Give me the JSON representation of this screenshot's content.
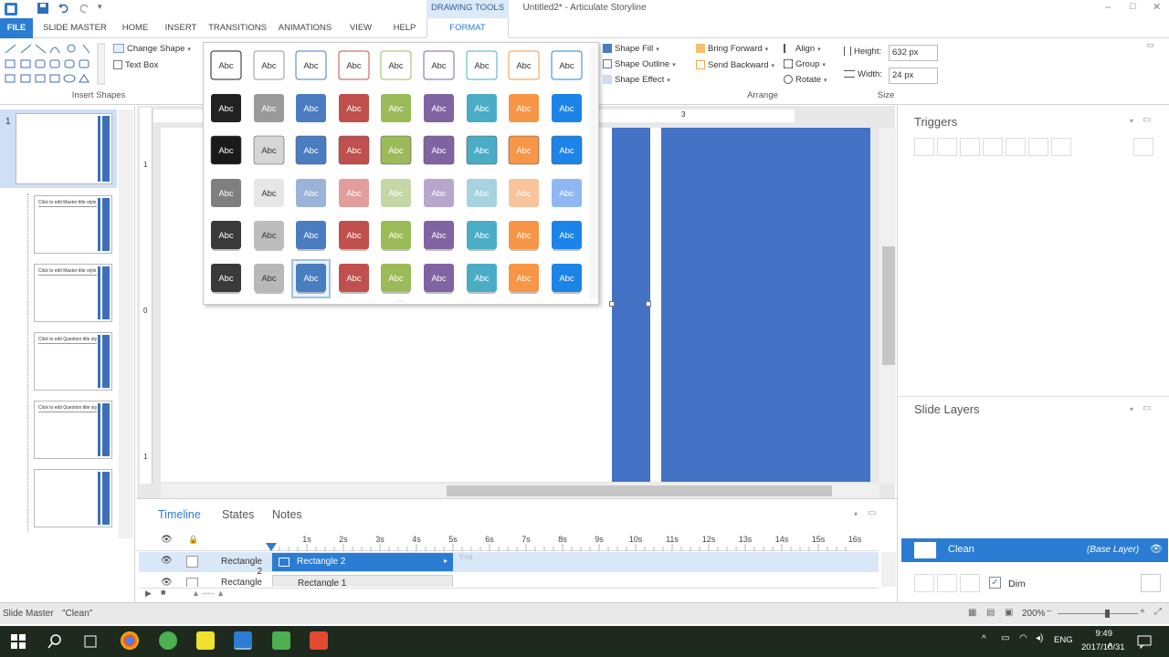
{
  "window": {
    "title": "Untitled2* - Articulate Storyline"
  },
  "context_tab": "DRAWING TOOLS",
  "tabs": [
    "FILE",
    "SLIDE MASTER",
    "HOME",
    "INSERT",
    "TRANSITIONS",
    "ANIMATIONS",
    "VIEW",
    "HELP",
    "FORMAT"
  ],
  "ribbon": {
    "insert_shapes_label": "Insert Shapes",
    "change_shape": "Change Shape",
    "text_box": "Text Box",
    "shape_fill": "Shape Fill",
    "shape_outline": "Shape Outline",
    "shape_effect": "Shape Effect",
    "bring_forward": "Bring Forward",
    "send_backward": "Send Backward",
    "align": "Align",
    "group": "Group",
    "rotate": "Rotate",
    "arrange_label": "Arrange",
    "height_label": "Height:",
    "height_value": "632 px",
    "width_label": "Width:",
    "width_value": "24 px",
    "size_label": "Size"
  },
  "gallery": {
    "swatch_text": "Abc",
    "colors": [
      "#222222",
      "#9a9a9a",
      "#4a7cc0",
      "#c0504d",
      "#9bbb59",
      "#8064a2",
      "#4bacc6",
      "#f79646",
      "#1c84e8"
    ],
    "light_colors": [
      "#d6d6d6",
      "#e0e0e0",
      "#9bb3d9",
      "#e29e9c",
      "#c5d7a6",
      "#b7a7cc",
      "#a6d3e0",
      "#f9c39b",
      "#8fb8f2"
    ],
    "selected": {
      "row": 5,
      "col": 2
    }
  },
  "slide_panel": {
    "slide_number": "1",
    "thumbnails": [
      {
        "header": "Click to edit Master title style"
      },
      {
        "header": "Click to edit Master title style"
      },
      {
        "header": "Click to edit Question title style"
      },
      {
        "header": "Click to edit Question title style"
      },
      {
        "header": ""
      }
    ]
  },
  "ruler": {
    "v_marks": [
      "1",
      "0",
      "1"
    ],
    "h_mark": "3"
  },
  "right_panel": {
    "triggers_title": "Triggers",
    "layers_title": "Slide Layers",
    "layer_name": "Clean",
    "base_layer": "(Base Layer)",
    "dim_label": "Dim"
  },
  "bottom_panel": {
    "tabs": [
      "Timeline",
      "States",
      "Notes"
    ],
    "ticks": [
      "1s",
      "2s",
      "3s",
      "4s",
      "5s",
      "6s",
      "7s",
      "8s",
      "9s",
      "10s",
      "11s",
      "12s",
      "13s",
      "14s",
      "15s",
      "16s"
    ],
    "end_label": "End",
    "rows": [
      {
        "name": "Rectangle 2",
        "bar": "Rectangle 2"
      },
      {
        "name": "Rectangle 1",
        "bar": "Rectangle 1"
      }
    ]
  },
  "status": {
    "left": "Slide Master",
    "theme": "\"Clean\"",
    "zoom": "200%"
  },
  "taskbar": {
    "lang": "ENG",
    "time": "9:49 م",
    "date": "2017/10/31"
  },
  "colors": {
    "accent": "#2b7cd3",
    "slide_blue": "#4472c4"
  }
}
